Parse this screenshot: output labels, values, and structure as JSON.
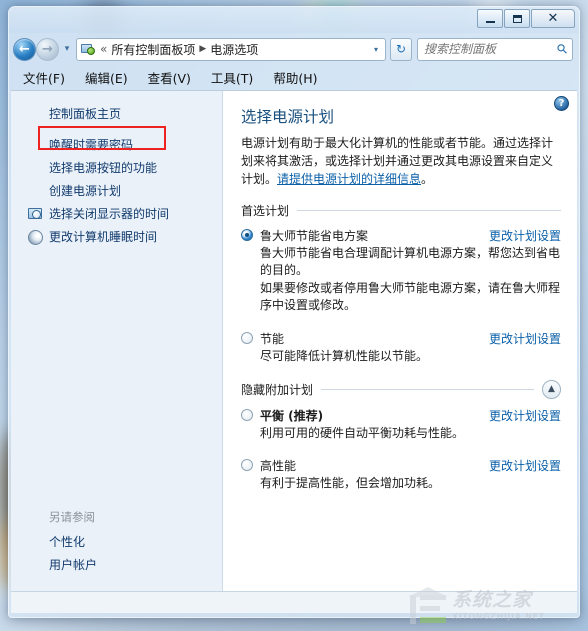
{
  "window": {
    "controls": {
      "minimize": "—",
      "maximize": "▢",
      "close": "✕"
    }
  },
  "navbar": {
    "back_icon": "back-arrow-icon",
    "forward_icon": "forward-arrow-icon",
    "history_caret": "▾",
    "address": {
      "icon": "control-panel-icon",
      "overflow_chevron": "«",
      "crumb1": "所有控制面板项",
      "separator": "▶",
      "crumb2": "电源选项",
      "dropdown_caret": "▾"
    },
    "refresh_icon": "↻",
    "search": {
      "placeholder": "搜索控制面板",
      "value": "",
      "icon": "search-icon"
    }
  },
  "menubar": {
    "items": [
      {
        "label": "文件(F)"
      },
      {
        "label": "编辑(E)"
      },
      {
        "label": "查看(V)"
      },
      {
        "label": "工具(T)"
      },
      {
        "label": "帮助(H)"
      }
    ]
  },
  "sidebar": {
    "home": "控制面板主页",
    "links": [
      {
        "label": "唤醒时需要密码",
        "icon": null,
        "highlighted": true
      },
      {
        "label": "选择电源按钮的功能",
        "icon": null
      },
      {
        "label": "创建电源计划",
        "icon": null
      },
      {
        "label": "选择关闭显示器的时间",
        "icon": "monitor-clock-icon"
      },
      {
        "label": "更改计算机睡眠时间",
        "icon": "moon-sleep-icon"
      }
    ],
    "see_also": {
      "title": "另请参阅",
      "links": [
        {
          "label": "个性化"
        },
        {
          "label": "用户帐户"
        }
      ]
    }
  },
  "main": {
    "help_icon": "?",
    "title": "选择电源计划",
    "description_part1": "电源计划有助于最大化计算机的性能或者节能。通过选择计划来将其激活，或选择计划并通过更改其电源设置来自定义计划。",
    "description_link": "请提供电源计划的详细信息",
    "description_part2": "。",
    "preferred_group": {
      "label": "首选计划",
      "plans": [
        {
          "name": "鲁大师节能省电方案",
          "selected": true,
          "bold": false,
          "link": "更改计划设置",
          "desc": "鲁大师节能省电合理调配计算机电源方案，帮您达到省电的目的。\n如果要修改或者停用鲁大师节能电源方案，请在鲁大师程序中设置或修改。"
        },
        {
          "name": "节能",
          "selected": false,
          "bold": false,
          "link": "更改计划设置",
          "desc": "尽可能降低计算机性能以节能。"
        }
      ]
    },
    "hidden_group": {
      "label": "隐藏附加计划",
      "collapse_icon": "▲",
      "plans": [
        {
          "name": "平衡 (推荐)",
          "selected": false,
          "bold": true,
          "link": "更改计划设置",
          "desc": "利用可用的硬件自动平衡功耗与性能。"
        },
        {
          "name": "高性能",
          "selected": false,
          "bold": false,
          "link": "更改计划设置",
          "desc": "有利于提高性能，但会增加功耗。"
        }
      ]
    }
  },
  "watermark": {
    "cn": "系统之家",
    "en": "XITONGZHIJIA.NET"
  }
}
